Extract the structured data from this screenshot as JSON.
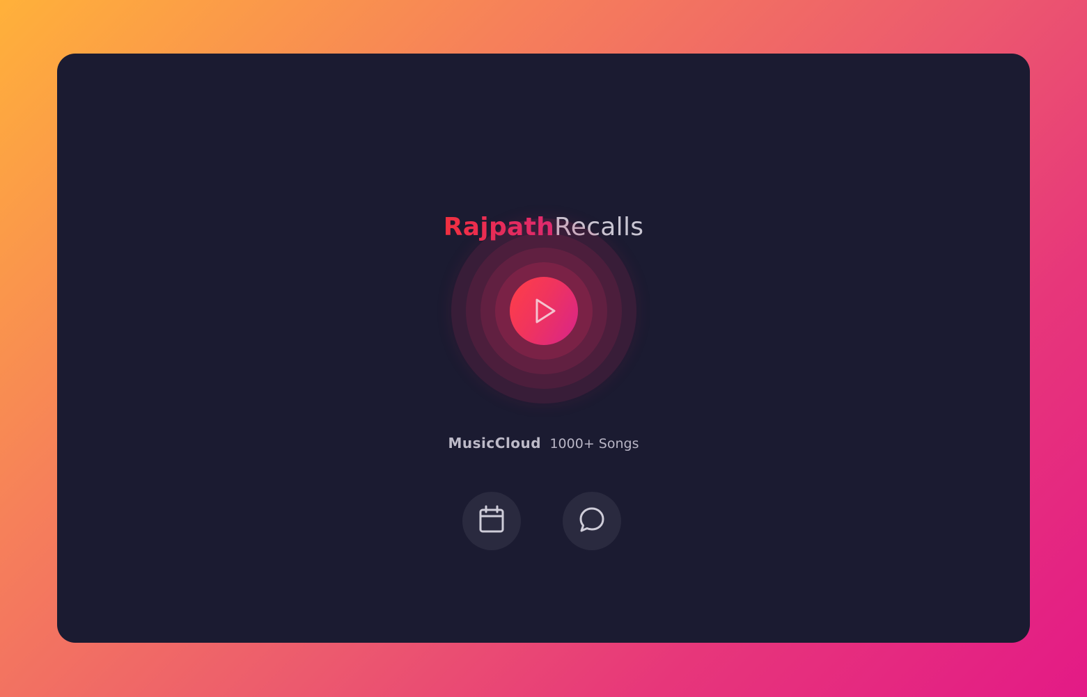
{
  "brand": {
    "first": "Rajpath",
    "second": "Recalls"
  },
  "player": {
    "play_icon": "play-icon"
  },
  "caption": {
    "title": "MusicCloud",
    "subtitle": "1000+ Songs"
  },
  "actions": {
    "calendar_icon": "calendar-icon",
    "chat_icon": "chat-bubble-icon"
  },
  "colors": {
    "background_start": "#ffb13a",
    "background_end": "#e31a86",
    "card": "#1b1b31",
    "accent_red": "#f0303f",
    "accent_pink": "#d8248a",
    "icon_button": "#2a2a3f",
    "text_muted": "#c9c6d3"
  }
}
